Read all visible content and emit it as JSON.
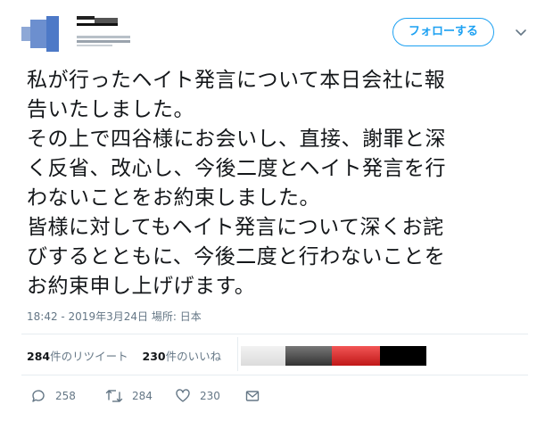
{
  "header": {
    "follow_label": "フォローする"
  },
  "tweet": {
    "text": "私が行ったヘイト発言について本日会社に報\n告いたしました。\nその上で四谷様にお会いし、直接、謝罪と深\nく反省、改心し、今後二度とヘイト発言を行\nわないことをお約束しました。\n皆様に対してもヘイト発言について深くお詫\nびするとともに、今後二度と行わないことを\nお約束申し上げげます。",
    "timestamp": "18:42 - 2019年3月24日",
    "location_prefix": "場所:",
    "location": "日本"
  },
  "stats": {
    "retweet_count": "284",
    "retweet_label": "件のリツイート",
    "like_count": "230",
    "like_label": "件のいいね"
  },
  "actions": {
    "reply_count": "258",
    "retweet_count": "284",
    "like_count": "230"
  },
  "colors": {
    "accent": "#1da1f2",
    "secondary_text": "#657786"
  }
}
